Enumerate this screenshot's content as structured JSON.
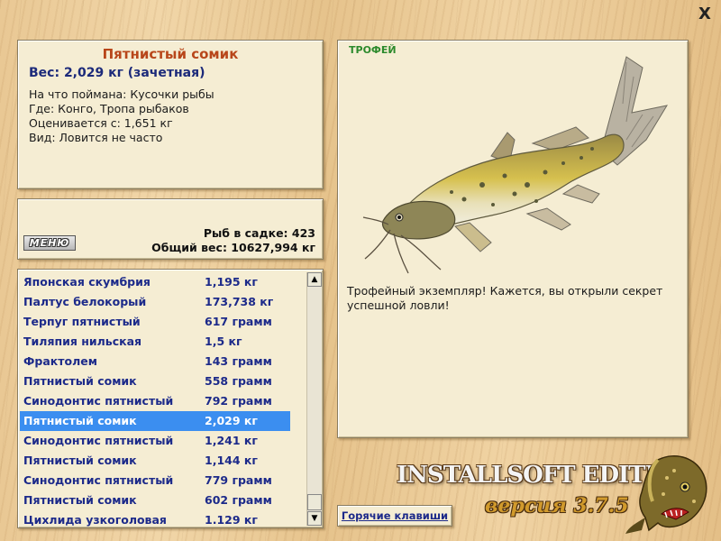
{
  "close_symbol": "X",
  "info": {
    "name": "Пятнистый сомик",
    "weight": "Вес: 2,029 кг (зачетная)",
    "lines": [
      "На что поймана: Кусочки рыбы",
      "Где: Конго, Тропа рыбаков",
      "Оценивается с: 1,651 кг",
      "Вид: Ловится не часто"
    ]
  },
  "stats": {
    "menu_label": "МЕНЮ",
    "fish_count": "Рыб в садке: 423",
    "total_weight": "Общий вес: 10627,994 кг"
  },
  "catch_list": {
    "selected_index": 7,
    "rows": [
      {
        "name": "Японская скумбрия",
        "weight": "1,195 кг"
      },
      {
        "name": "Палтус белокорый",
        "weight": "173,738 кг"
      },
      {
        "name": "Терпуг пятнистый",
        "weight": "617 грамм"
      },
      {
        "name": "Тиляпия нильская",
        "weight": "1,5 кг"
      },
      {
        "name": "Фрактолем",
        "weight": "143 грамм"
      },
      {
        "name": "Пятнистый сомик",
        "weight": "558 грамм"
      },
      {
        "name": "Синодонтис пятнистый",
        "weight": "792 грамм"
      },
      {
        "name": "Пятнистый сомик",
        "weight": "2,029 кг"
      },
      {
        "name": "Синодонтис пятнистый",
        "weight": "1,241 кг"
      },
      {
        "name": "Пятнистый сомик",
        "weight": "1,144 кг"
      },
      {
        "name": "Синодонтис пятнистый",
        "weight": "779 грамм"
      },
      {
        "name": "Пятнистый сомик",
        "weight": "602 грамм"
      },
      {
        "name": "Цихлида узкоголовая",
        "weight": "1.129 кг"
      }
    ]
  },
  "trophy": {
    "label": "ТРОФЕЙ",
    "description": "Трофейный экземпляр! Кажется, вы открыли секрет успешной ловли!"
  },
  "hotkeys_label": "Горячие клавиши",
  "brand": {
    "edition": "INSTALLSOFT EDITION",
    "version": "версия 3.7.5"
  },
  "icons": {
    "close": "close-icon",
    "scroll_up": "arrow-up-icon",
    "scroll_down": "arrow-down-icon",
    "trophy_fish": "catfish-image",
    "logo": "pike-logo"
  }
}
